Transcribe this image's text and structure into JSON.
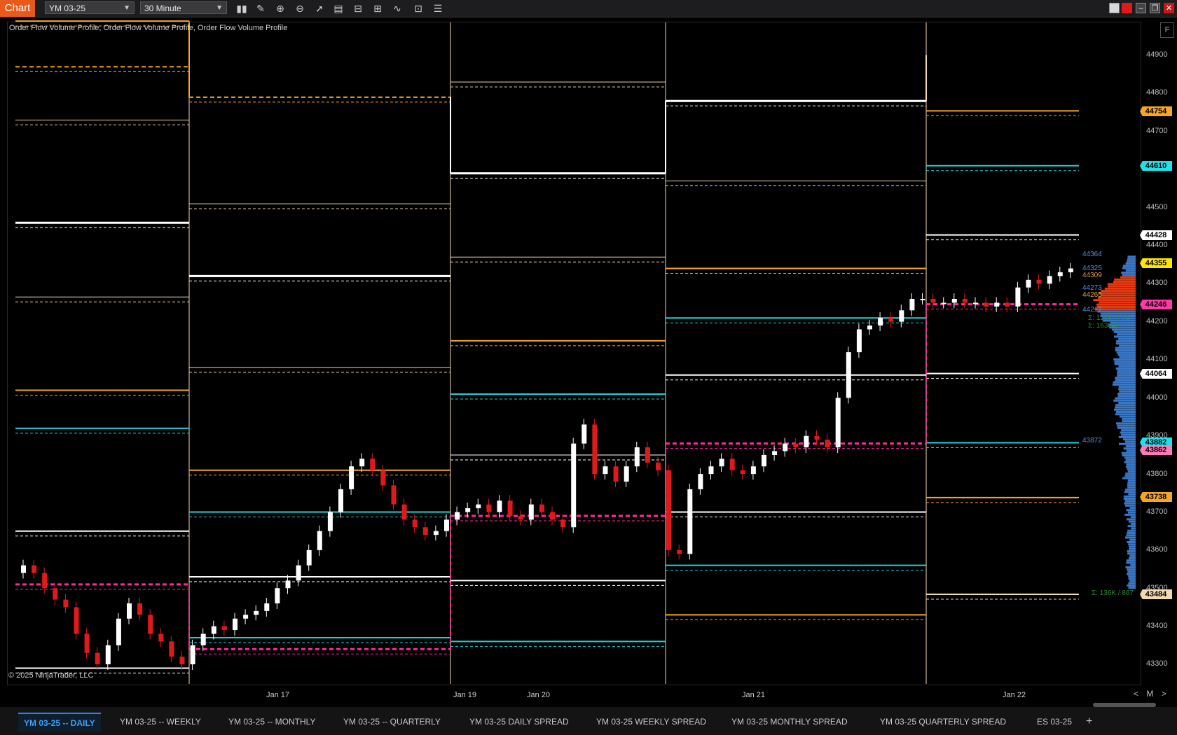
{
  "window": {
    "tab_label": "Chart",
    "instrument": "YM 03-25",
    "interval": "30 Minute",
    "indicators_label": "Order Flow Volume Profile, Order Flow Volume Profile, Order Flow Volume Profile",
    "copyright": "© 2025 NinjaTrader, LLC",
    "f_button": "F"
  },
  "toolbar_icons": [
    "bar-style-icon",
    "pencil-icon",
    "zoom-in-icon",
    "zoom-out-icon",
    "pointer-icon",
    "data-box-icon",
    "properties-icon",
    "templates-icon",
    "indicators-icon",
    "strategies-icon",
    "list-icon"
  ],
  "price_axis": {
    "ticks": [
      "44900",
      "44800",
      "44700",
      "44600",
      "44500",
      "44400",
      "44300",
      "44200",
      "44100",
      "44000",
      "43900",
      "43800",
      "43700",
      "43600",
      "43500",
      "43400",
      "43300"
    ],
    "markers": [
      {
        "label": "44754",
        "color": "#f5a623"
      },
      {
        "label": "44610",
        "color": "#20e0e8"
      },
      {
        "label": "44428",
        "color": "#ffffff"
      },
      {
        "label": "44355",
        "color": "#ffe600"
      },
      {
        "label": "44246",
        "color": "#ff3aa8"
      },
      {
        "label": "44064",
        "color": "#ffffff"
      },
      {
        "label": "43882",
        "color": "#20e0e8"
      },
      {
        "label": "43862",
        "color": "#ff7ab8"
      },
      {
        "label": "43738",
        "color": "#f5a623"
      },
      {
        "label": "43484",
        "color": "#f3d9b1"
      }
    ]
  },
  "profile_labels": [
    {
      "text": "44364",
      "color": "#5a8fe0"
    },
    {
      "text": "44325",
      "color": "#5a8fe0"
    },
    {
      "text": "44309",
      "color": "#e8a040"
    },
    {
      "text": "44273",
      "color": "#5a8fe0"
    },
    {
      "text": "44265",
      "color": "#e8a040"
    },
    {
      "text": "44217",
      "color": "#5a8fe0"
    },
    {
      "text": "Σ: 12087 / 15",
      "color": "#2e8b2e"
    },
    {
      "text": "Σ: 16334 / 1",
      "color": "#2e8b2e"
    },
    {
      "text": "43872",
      "color": "#5a8fe0"
    },
    {
      "text": "Σ: 136K / 867",
      "color": "#2e8b2e"
    }
  ],
  "time_axis": {
    "labels": [
      "Jan 17",
      "Jan 19",
      "Jan 20",
      "Jan 21",
      "Jan 22"
    ],
    "nav": [
      "<",
      "M",
      ">"
    ]
  },
  "tabs": [
    {
      "label": "YM 03-25 -- DAILY",
      "active": true
    },
    {
      "label": "YM 03-25 -- WEEKLY"
    },
    {
      "label": "YM 03-25 -- MONTHLY"
    },
    {
      "label": "YM 03-25 -- QUARTERLY"
    },
    {
      "label": "YM 03-25 DAILY SPREAD"
    },
    {
      "label": "YM 03-25 WEEKLY SPREAD"
    },
    {
      "label": "YM 03-25 MONTHLY SPREAD"
    },
    {
      "label": "YM 03-25 QUARTERLY SPREAD"
    },
    {
      "label": "ES 03-25"
    }
  ],
  "add_tab": "+",
  "colors": {
    "up_candle": "#ffffff",
    "down_candle": "#e01a1a",
    "orange": "#f5a623",
    "cream": "#f3d9b1",
    "cyan": "#20d0d8",
    "magenta": "#ff2a9a",
    "volume_blue": "#3a78c8",
    "volume_red": "#e83a10"
  }
}
